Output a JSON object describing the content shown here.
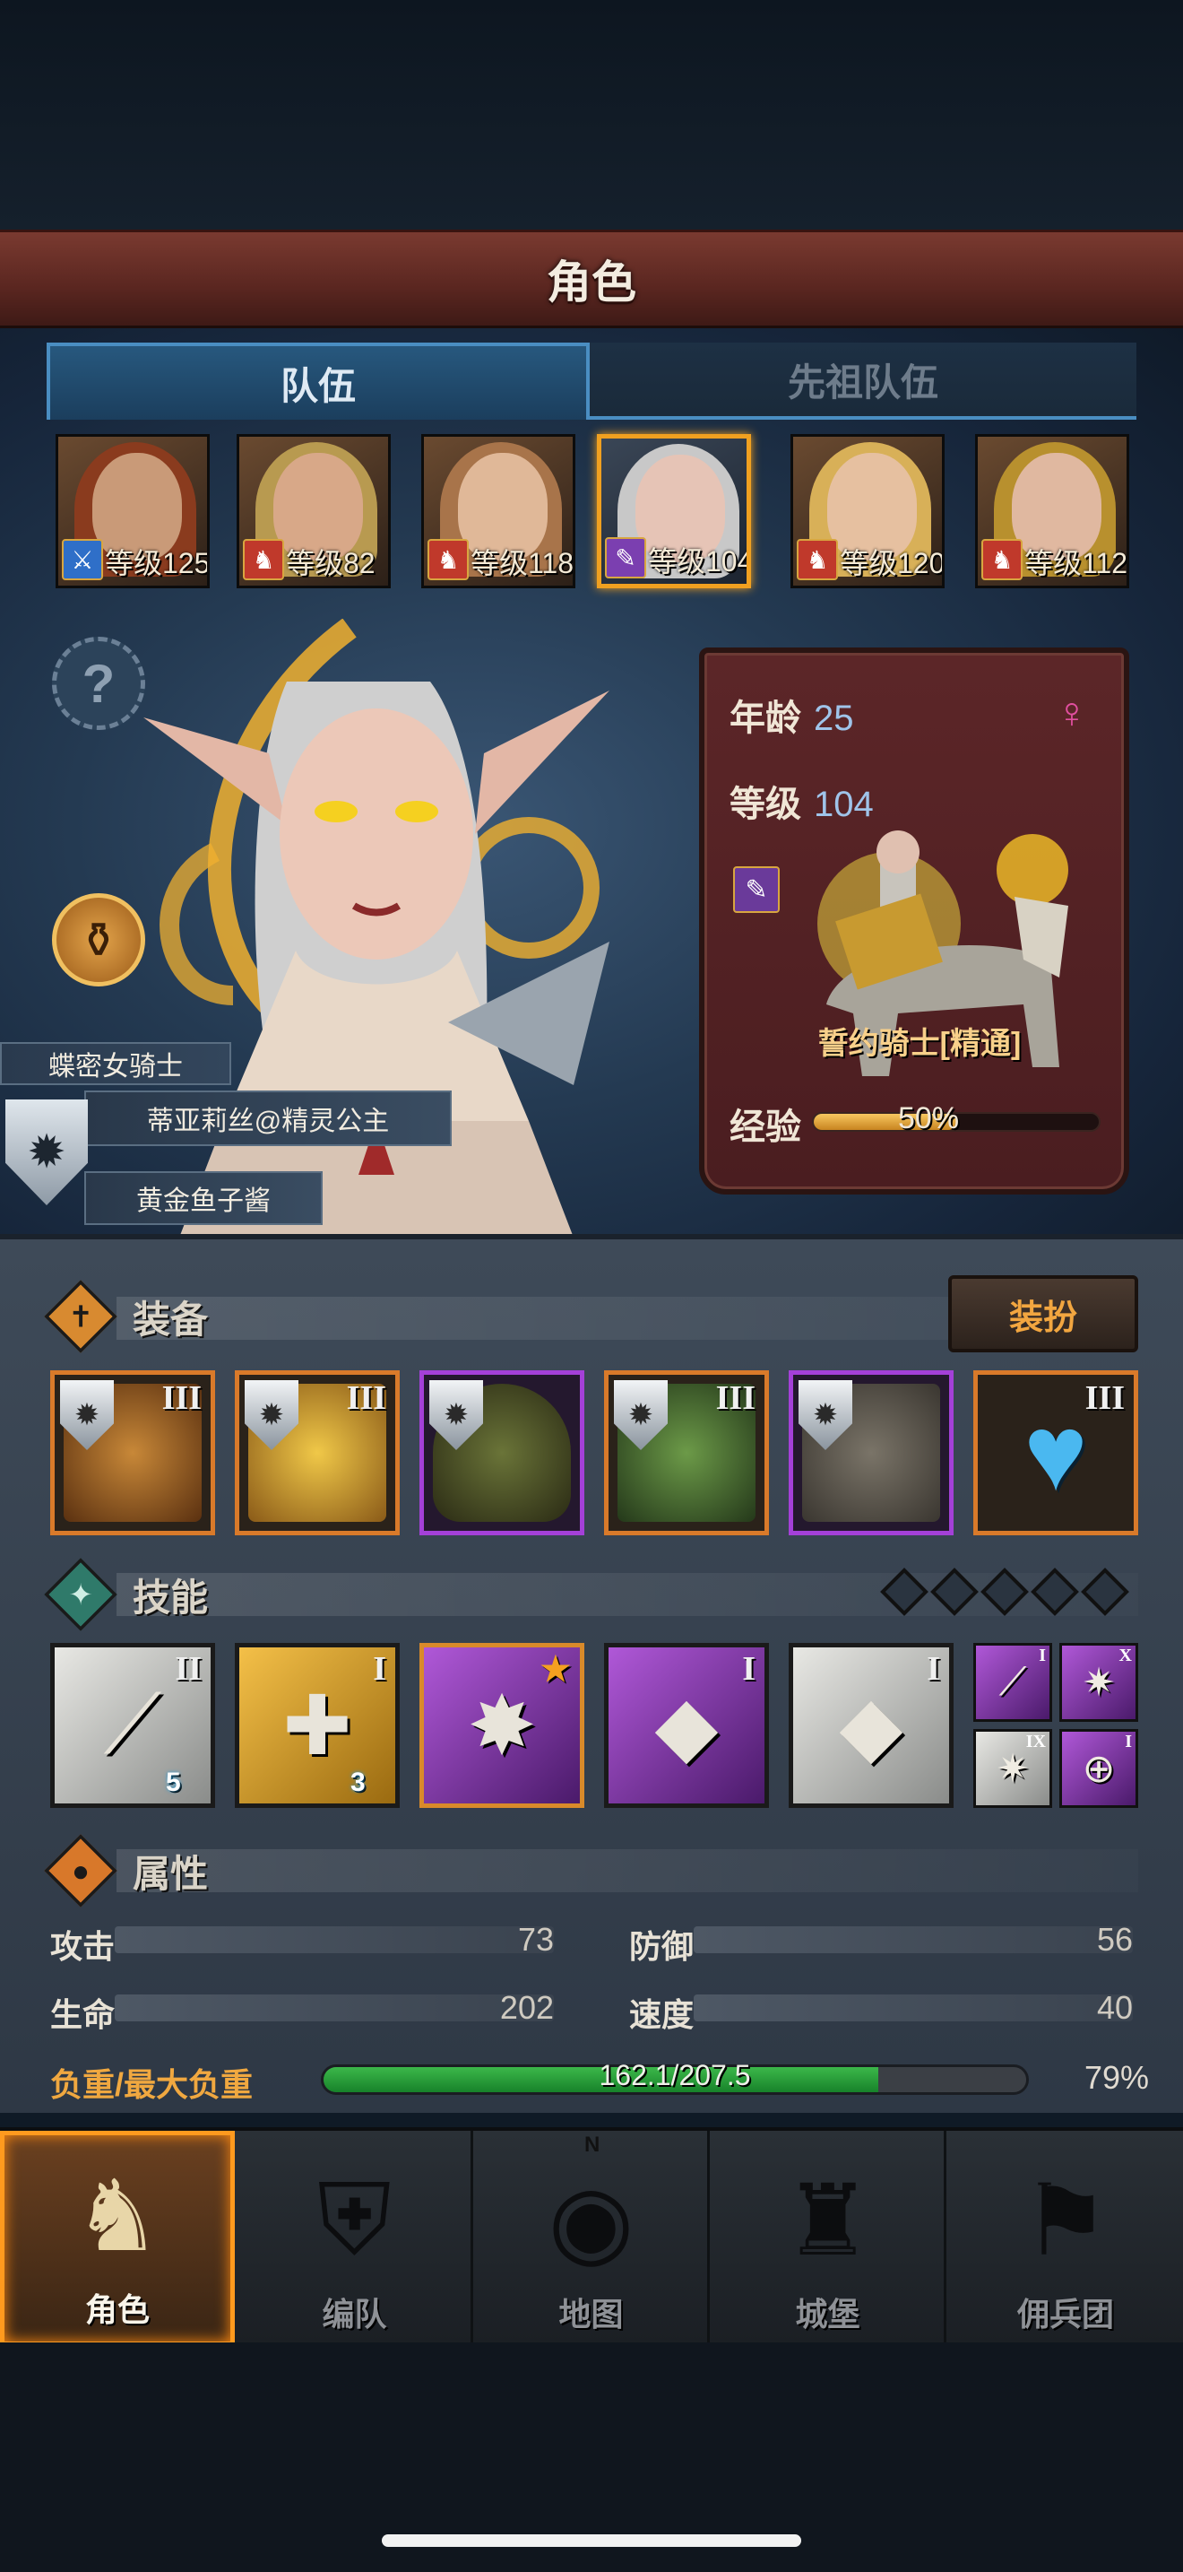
{
  "header": {
    "title": "角色"
  },
  "tabs": [
    {
      "label": "队伍",
      "active": true
    },
    {
      "label": "先祖队伍",
      "active": false
    }
  ],
  "roster": [
    {
      "level_text": "等级125",
      "class_icon": "sword-icon",
      "class_color": "#2f6fc8",
      "selected": false
    },
    {
      "level_text": "等级82",
      "class_icon": "wolf-icon",
      "class_color": "#c0392b",
      "selected": false
    },
    {
      "level_text": "等级118",
      "class_icon": "wolf-icon",
      "class_color": "#c0392b",
      "selected": false
    },
    {
      "level_text": "等级104",
      "class_icon": "wand-icon",
      "class_color": "#7b3fb0",
      "selected": true
    },
    {
      "level_text": "等级120",
      "class_icon": "wolf-icon",
      "class_color": "#c0392b",
      "selected": false
    },
    {
      "level_text": "等级112",
      "class_icon": "wolf-icon",
      "class_color": "#c0392b",
      "selected": false
    }
  ],
  "character": {
    "title": "蝶密女骑士",
    "name": "蒂亚莉丝@精灵公主",
    "guild": "黄金鱼子酱",
    "age_label": "年龄",
    "age": "25",
    "level_label": "等级",
    "level": "104",
    "mount_name": "誓约骑士[精通]",
    "exp_label": "经验",
    "exp_percent_text": "50%",
    "exp_fraction": 0.5,
    "gender": "female"
  },
  "equipment": {
    "label": "装备",
    "dress_button": "装扮",
    "items": [
      {
        "rarity": "orange",
        "tier": "III",
        "has_shield": true,
        "icon": "lamp-icon"
      },
      {
        "rarity": "orange",
        "tier": "III",
        "has_shield": true,
        "icon": "tome-icon"
      },
      {
        "rarity": "purple",
        "tier": "",
        "has_shield": true,
        "icon": "hood-icon"
      },
      {
        "rarity": "orange",
        "tier": "III",
        "has_shield": true,
        "icon": "armor-icon"
      },
      {
        "rarity": "purple",
        "tier": "",
        "has_shield": true,
        "icon": "boots-icon"
      },
      {
        "rarity": "orange",
        "tier": "III",
        "has_shield": false,
        "icon": "heart-amulet-icon"
      }
    ]
  },
  "skills": {
    "label": "技能",
    "slots_empty": 5,
    "items": [
      {
        "tier": "II",
        "count": "5",
        "style": "silver",
        "icon": "spear-icon"
      },
      {
        "tier": "I",
        "count": "3",
        "style": "gold",
        "icon": "heal-shield-icon"
      },
      {
        "tier": "",
        "count": "",
        "style": "purple",
        "icon": "burst-icon",
        "starred": true
      },
      {
        "tier": "I",
        "count": "",
        "style": "purple",
        "icon": "crystal-hand-icon"
      },
      {
        "tier": "I",
        "count": "",
        "style": "silver",
        "icon": "crystal-hand-icon"
      }
    ],
    "minis": [
      {
        "tier": "I",
        "style": "purple",
        "icon": "staff-icon"
      },
      {
        "tier": "X",
        "style": "purple",
        "icon": "explosion-icon"
      },
      {
        "tier": "IX",
        "style": "silver",
        "icon": "explosion-icon"
      },
      {
        "tier": "I",
        "style": "purple",
        "icon": "target-icon"
      }
    ]
  },
  "attributes": {
    "label": "属性",
    "attack_label": "攻击",
    "attack": "73",
    "defense_label": "防御",
    "defense": "56",
    "hp_label": "生命",
    "hp": "202",
    "speed_label": "速度",
    "speed": "40",
    "load_label": "负重/最大负重",
    "load_text": "162.1/207.5",
    "load_percent_text": "79%",
    "load_fraction": 0.79
  },
  "nav": [
    {
      "label": "角色",
      "icon": "knight-icon",
      "active": true
    },
    {
      "label": "编队",
      "icon": "helmet-icon",
      "active": false
    },
    {
      "label": "地图",
      "icon": "compass-map-icon",
      "active": false,
      "compass_letter": "N"
    },
    {
      "label": "城堡",
      "icon": "castle-icon",
      "active": false
    },
    {
      "label": "佣兵团",
      "icon": "banner-icon",
      "active": false
    }
  ],
  "colors": {
    "accent_orange": "#f0a020",
    "title_red": "#5a2620",
    "exp_gold": "#f7c860",
    "load_green": "#3cb84a"
  }
}
